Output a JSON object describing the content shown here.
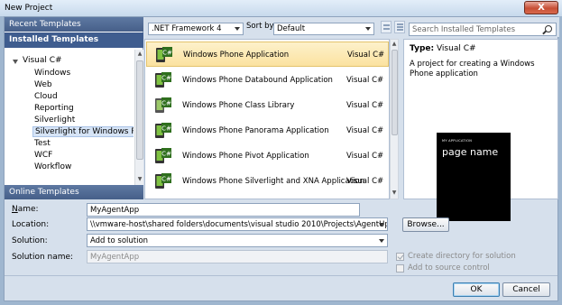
{
  "window": {
    "title": "New Project",
    "close_label": "X"
  },
  "left": {
    "recent_header": "Recent Templates",
    "installed_header": "Installed Templates",
    "tree": [
      "Visual C#",
      "Windows",
      "Web",
      "Cloud",
      "Reporting",
      "Silverlight",
      "Silverlight for Windows Phone",
      "Test",
      "WCF",
      "Workflow"
    ],
    "online_header": "Online Templates"
  },
  "toolbar": {
    "framework": ".NET Framework 4",
    "sort_label": "Sort by:",
    "sort_value": "Default",
    "search_placeholder": "Search Installed Templates"
  },
  "templates": [
    {
      "name": "Windows Phone Application",
      "lang": "Visual C#",
      "selected": true
    },
    {
      "name": "Windows Phone Databound Application",
      "lang": "Visual C#",
      "selected": false
    },
    {
      "name": "Windows Phone Class Library",
      "lang": "Visual C#",
      "selected": false
    },
    {
      "name": "Windows Phone Panorama Application",
      "lang": "Visual C#",
      "selected": false
    },
    {
      "name": "Windows Phone Pivot Application",
      "lang": "Visual C#",
      "selected": false
    },
    {
      "name": "Windows Phone Silverlight and XNA Application",
      "lang": "Visual C#",
      "selected": false
    }
  ],
  "details": {
    "type_label": "Type:",
    "type_value": "Visual C#",
    "description": "A project for creating a Windows Phone application",
    "preview_app_title": "MY APPLICATION",
    "preview_page_name": "page name"
  },
  "form": {
    "name_label": "Name:",
    "name_value": "MyAgentApp",
    "location_label": "Location:",
    "location_value": "\\\\vmware-host\\shared folders\\documents\\visual studio 2010\\Projects\\AgentUpdateW",
    "browse_label": "Browse...",
    "solution_label": "Solution:",
    "solution_value": "Add to solution",
    "solution_name_label": "Solution name:",
    "solution_name_value": "MyAgentApp",
    "create_directory_label": "Create directory for solution",
    "create_directory_checked": true,
    "add_source_control_label": "Add to source control",
    "add_source_control_checked": false,
    "ok_label": "OK",
    "cancel_label": "Cancel"
  },
  "colors": {
    "selection_gold": "#fbe2a0",
    "header_blue": "#465f89",
    "window_bg": "#d6e0ec"
  }
}
